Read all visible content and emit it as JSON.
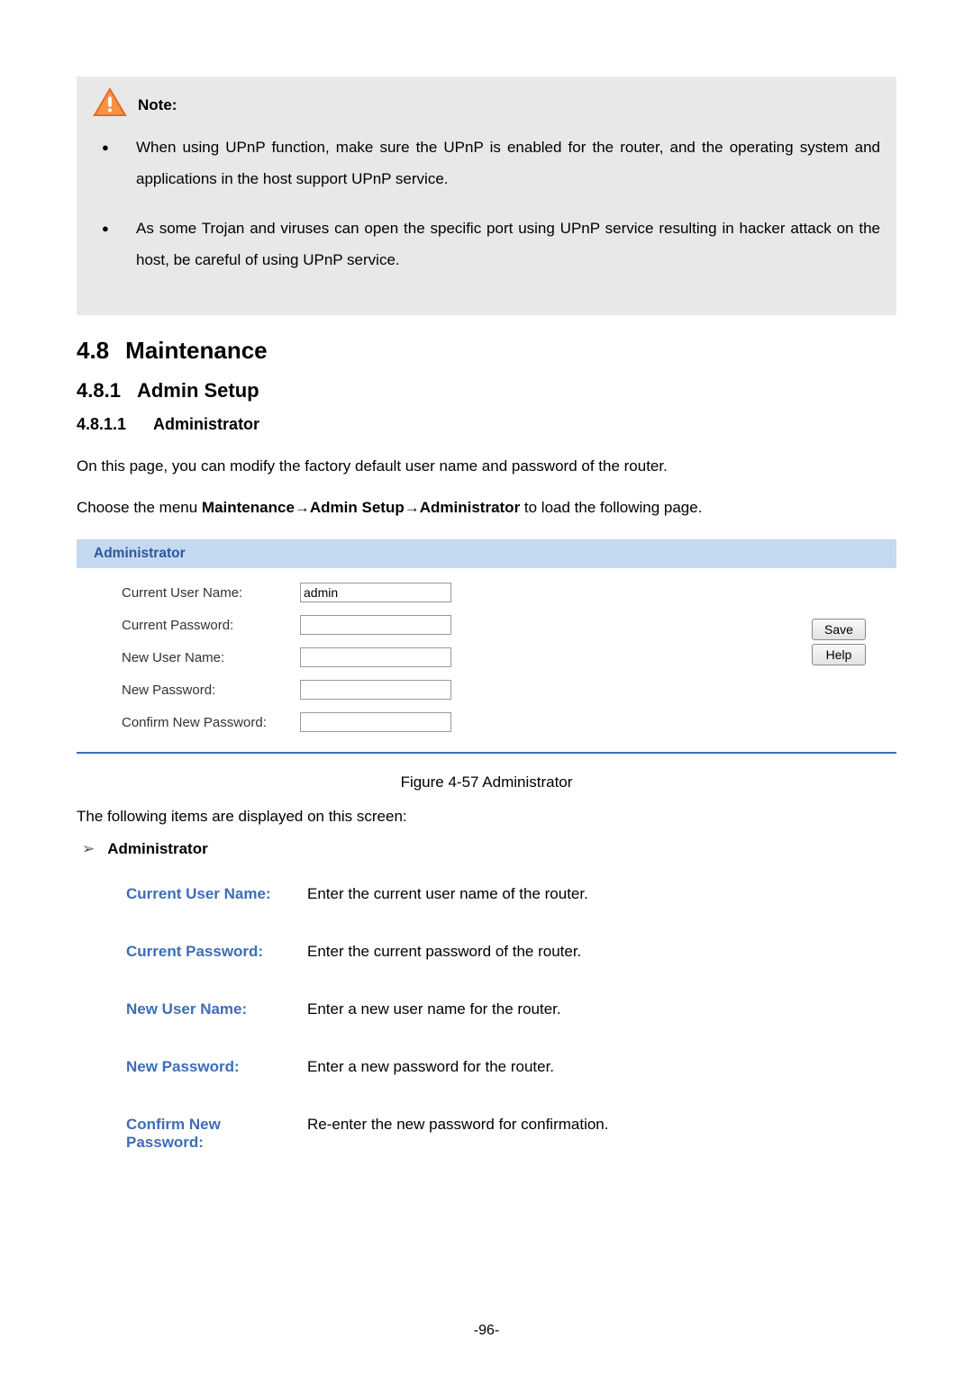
{
  "note": {
    "label": "Note:",
    "items": [
      "When using UPnP function, make sure the UPnP is enabled for the router, and the operating system and applications in the host support UPnP service.",
      "As some Trojan and viruses can open the specific port using UPnP service resulting in hacker attack on the host, be careful of using UPnP service."
    ]
  },
  "headings": {
    "h1_num": "4.8",
    "h1_text": "Maintenance",
    "h2_num": "4.8.1",
    "h2_text": "Admin Setup",
    "h3_num": "4.8.1.1",
    "h3_text": "Administrator"
  },
  "body_text": {
    "p1": "On this page, you can modify the factory default user name and password of the router.",
    "p2_pre": "Choose the menu ",
    "p2_menu": "Maintenance→Admin Setup→Administrator",
    "p2_suf": " to load the following page."
  },
  "panel": {
    "title": "Administrator",
    "fields": {
      "current_user_label": "Current User Name:",
      "current_user_value": "admin",
      "current_pass_label": "Current Password:",
      "current_pass_value": "",
      "new_user_label": "New User Name:",
      "new_user_value": "",
      "new_pass_label": "New Password:",
      "new_pass_value": "",
      "confirm_pass_label": "Confirm New Password:",
      "confirm_pass_value": ""
    },
    "buttons": {
      "save": "Save",
      "help": "Help"
    }
  },
  "figure_caption": "Figure 4-57 Administrator",
  "items_intro": "The following items are displayed on this screen:",
  "sub_heading": "Administrator",
  "definitions": [
    {
      "label": "Current User Name:",
      "desc": "Enter the current user name of the router."
    },
    {
      "label": "Current Password:",
      "desc": "Enter the current password of the router."
    },
    {
      "label": "New User Name:",
      "desc": "Enter a new user name for the router."
    },
    {
      "label": "New Password:",
      "desc": "Enter a new password for the router."
    },
    {
      "label": "Confirm New Password:",
      "desc": "Re-enter the new password for confirmation."
    }
  ],
  "page_number": "-96-"
}
